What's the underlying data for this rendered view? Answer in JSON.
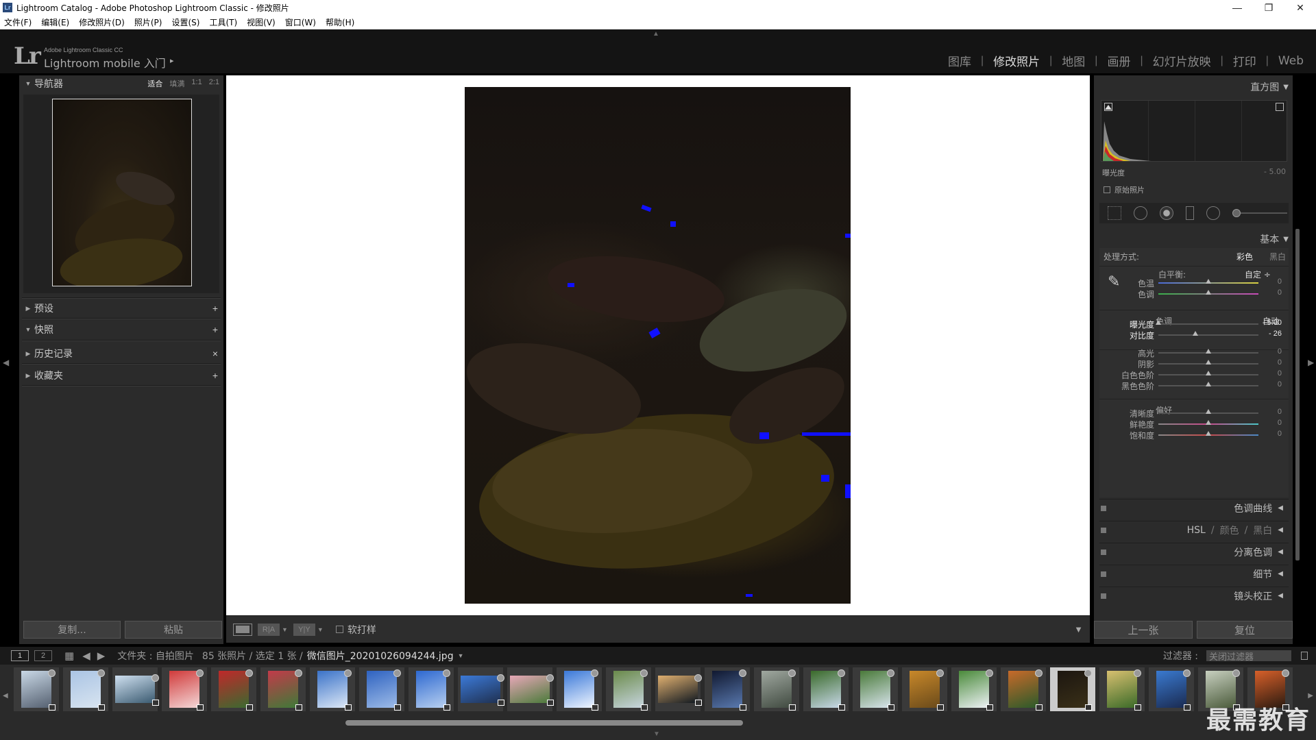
{
  "window": {
    "title": "Lightroom Catalog - Adobe Photoshop Lightroom Classic - 修改照片",
    "icon_text": "Lr"
  },
  "menu": [
    "文件(F)",
    "编辑(E)",
    "修改照片(D)",
    "照片(P)",
    "设置(S)",
    "工具(T)",
    "视图(V)",
    "窗口(W)",
    "帮助(H)"
  ],
  "brand": {
    "logo": "Lr",
    "sub": "Adobe Lightroom Classic CC",
    "main": "Lightroom mobile 入门",
    "arrow": "▸"
  },
  "modules": [
    {
      "label": "图库",
      "active": false
    },
    {
      "label": "修改照片",
      "active": true
    },
    {
      "label": "地图",
      "active": false
    },
    {
      "label": "画册",
      "active": false
    },
    {
      "label": "幻灯片放映",
      "active": false
    },
    {
      "label": "打印",
      "active": false
    },
    {
      "label": "Web",
      "active": false
    }
  ],
  "left_panel": {
    "navigator": {
      "title": "导航器",
      "zoom": [
        "适合",
        "填满",
        "1:1",
        "2:1"
      ]
    },
    "sections": [
      {
        "title": "预设",
        "action": "+"
      },
      {
        "title": "快照",
        "action": "+"
      },
      {
        "title": "历史记录",
        "action": "×"
      },
      {
        "title": "收藏夹",
        "action": "+"
      }
    ],
    "copy_label": "复制...",
    "paste_label": "粘贴"
  },
  "toolbar": {
    "chip_before_after": "R|A",
    "chip_yy": "Y|Y",
    "softproof_label": "软打样"
  },
  "right_panel": {
    "histogram": {
      "title": "直方图",
      "exposure_label": "曝光度",
      "exposure_value": "- 5.00",
      "original_label": "原始照片"
    },
    "basic": {
      "title": "基本",
      "treatment_label": "处理方式:",
      "treatment_color": "彩色",
      "treatment_bw": "黑白",
      "wb_label": "白平衡:",
      "wb_value": "自定 ÷",
      "tone_label": "色调",
      "auto_label": "自动",
      "presence_label": "偏好",
      "sliders": [
        {
          "label": "色温",
          "value": "0",
          "pos": 0.5
        },
        {
          "label": "色调",
          "value": "0",
          "pos": 0.5
        },
        {
          "label": "曝光度",
          "value": "- 5.00",
          "pos": 0.0
        },
        {
          "label": "对比度",
          "value": "- 26",
          "pos": 0.37
        },
        {
          "label": "高光",
          "value": "0",
          "pos": 0.5
        },
        {
          "label": "阴影",
          "value": "0",
          "pos": 0.5
        },
        {
          "label": "白色色阶",
          "value": "0",
          "pos": 0.5
        },
        {
          "label": "黑色色阶",
          "value": "0",
          "pos": 0.5
        },
        {
          "label": "清晰度",
          "value": "0",
          "pos": 0.5
        },
        {
          "label": "鲜艳度",
          "value": "0",
          "pos": 0.5
        },
        {
          "label": "饱和度",
          "value": "0",
          "pos": 0.5
        }
      ]
    },
    "panels": {
      "tone_curve": "色调曲线",
      "hsl": "HSL",
      "hsl_color": "颜色",
      "hsl_bw": "黑白",
      "split_toning": "分离色调",
      "detail": "细节",
      "lens": "镜头校正"
    },
    "prev_label": "上一张",
    "reset_label": "复位"
  },
  "filmstrip_bar": {
    "page1": "1",
    "page2": "2",
    "folder": "文件夹 : 自拍图片",
    "count": "85 张照片 / 选定 1 张 /",
    "filename": "微信图片_20201026094244.jpg",
    "filter_label": "过滤器 :",
    "filter_value": "关闭过滤器"
  },
  "filmstrip": {
    "thumbs": [
      {
        "c1": "#c9d8e6",
        "c2": "#556070",
        "wide": false
      },
      {
        "c1": "#aac4e4",
        "c2": "#d8e4f0",
        "wide": false
      },
      {
        "c1": "#cfe0f0",
        "c2": "#3a5a70",
        "wide": true
      },
      {
        "c1": "#d03a3a",
        "c2": "#f4d8d8",
        "wide": false
      },
      {
        "c1": "#c0282a",
        "c2": "#3a6a30",
        "wide": false
      },
      {
        "c1": "#c33a4a",
        "c2": "#3e7a38",
        "wide": false
      },
      {
        "c1": "#3a72c8",
        "c2": "#dde8f6",
        "wide": false
      },
      {
        "c1": "#2e62c0",
        "c2": "#9ebce8",
        "wide": false
      },
      {
        "c1": "#2d68d0",
        "c2": "#b8d0f0",
        "wide": false
      },
      {
        "c1": "#3c7ad8",
        "c2": "#1f3050",
        "wide": true
      },
      {
        "c1": "#e8a8b8",
        "c2": "#4a7a3a",
        "wide": true
      },
      {
        "c1": "#3a78d8",
        "c2": "#f0f6ff",
        "wide": false
      },
      {
        "c1": "#6a8a4a",
        "c2": "#c8d6e0",
        "wide": false
      },
      {
        "c1": "#e0b070",
        "c2": "#101820",
        "wide": true
      },
      {
        "c1": "#101830",
        "c2": "#5a7ab0",
        "wide": false
      },
      {
        "c1": "#a0a8a0",
        "c2": "#404a40",
        "wide": false
      },
      {
        "c1": "#3a6a2a",
        "c2": "#c8d8e8",
        "wide": false
      },
      {
        "c1": "#4a7a3a",
        "c2": "#d8e4ec",
        "wide": false
      },
      {
        "c1": "#c8882a",
        "c2": "#6a4a1a",
        "wide": false
      },
      {
        "c1": "#4a8a3a",
        "c2": "#eef2f6",
        "wide": false
      },
      {
        "c1": "#c86a2a",
        "c2": "#2a5a2a",
        "wide": false
      },
      {
        "c1": "#1c1610",
        "c2": "#3a3018",
        "wide": false
      },
      {
        "c1": "#d8c070",
        "c2": "#3a6a28",
        "wide": false
      },
      {
        "c1": "#3a7ad0",
        "c2": "#1a2a50",
        "wide": false
      },
      {
        "c1": "#c8d0c0",
        "c2": "#4a5a3a",
        "wide": false
      },
      {
        "c1": "#d8602a",
        "c2": "#2a1a10",
        "wide": false
      }
    ],
    "selected_index": 21
  },
  "watermark": "最需教育",
  "colors": {
    "clip_blue": "#1010ff",
    "panel_bg": "#2b2b2b",
    "accent_text": "#dddddd"
  }
}
